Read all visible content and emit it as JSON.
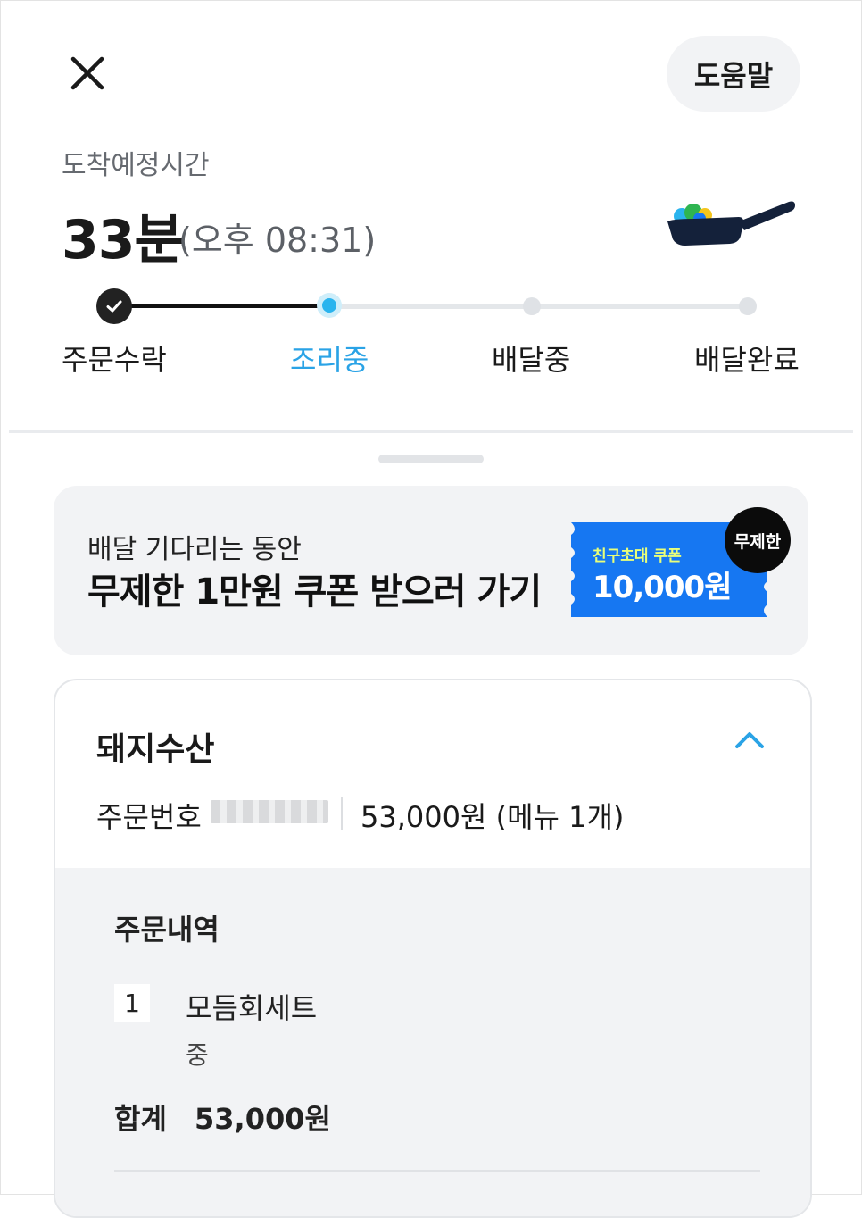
{
  "header": {
    "help_label": "도움말"
  },
  "eta": {
    "label": "도착예정시간",
    "minutes": "33분",
    "clock": "(오후 08:31)"
  },
  "progress": {
    "steps": [
      {
        "label": "주문수락",
        "state": "done"
      },
      {
        "label": "조리중",
        "state": "current"
      },
      {
        "label": "배달중",
        "state": "pending"
      },
      {
        "label": "배달완료",
        "state": "pending"
      }
    ]
  },
  "banner": {
    "subtitle": "배달 기다리는 동안",
    "title": "무제한 1만원 쿠폰 받으러 가기",
    "coupon_label": "친구초대 쿠폰",
    "coupon_amount": "10,000원",
    "badge": "무제한"
  },
  "order": {
    "store_name": "돼지수산",
    "order_number_label": "주문번호",
    "summary": "53,000원 (메뉴 1개)",
    "detail_title": "주문내역",
    "items": [
      {
        "qty": "1",
        "name": "모듬회세트",
        "option": "중"
      }
    ],
    "total_label": "합계",
    "total_value": "53,000원"
  },
  "colors": {
    "accent": "#2aa3e6",
    "coupon_blue": "#1677f2",
    "panel_gray": "#f2f3f5"
  },
  "icons": [
    "close-icon",
    "frying-pan-icon",
    "check-icon",
    "chevron-up-icon"
  ]
}
